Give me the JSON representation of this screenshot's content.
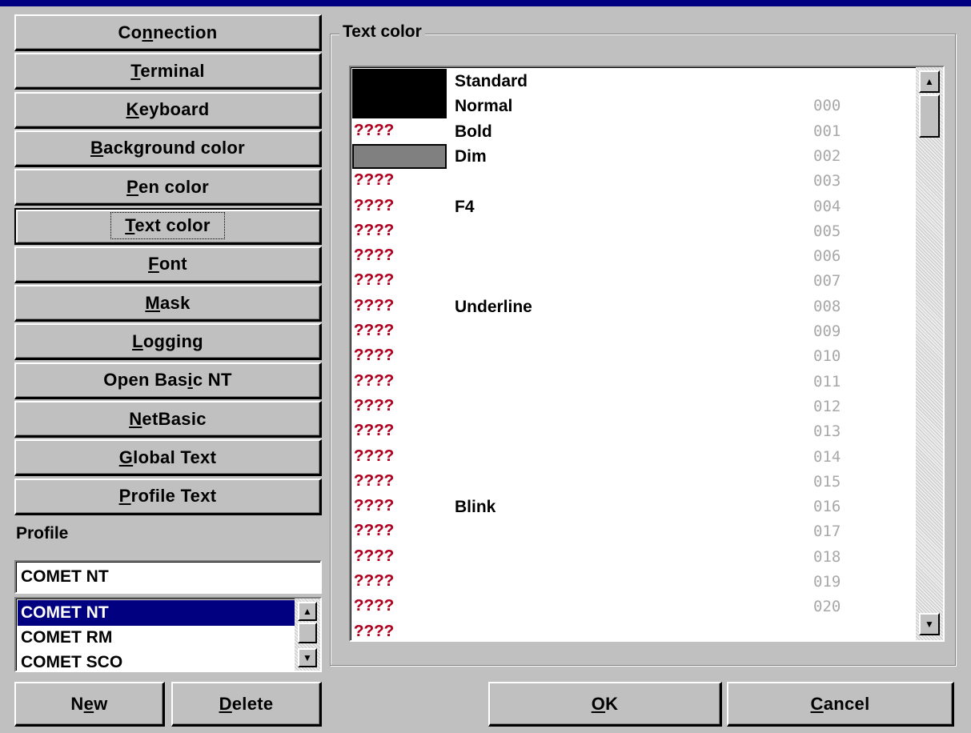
{
  "nav_buttons": [
    {
      "pre": "Co",
      "ul": "n",
      "post": "nection"
    },
    {
      "pre": "",
      "ul": "T",
      "post": "erminal"
    },
    {
      "pre": "",
      "ul": "K",
      "post": "eyboard"
    },
    {
      "pre": "",
      "ul": "B",
      "post": "ackground color"
    },
    {
      "pre": "",
      "ul": "P",
      "post": "en color"
    },
    {
      "pre": "",
      "ul": "T",
      "post": "ext color"
    },
    {
      "pre": "",
      "ul": "F",
      "post": "ont"
    },
    {
      "pre": "",
      "ul": "M",
      "post": "ask"
    },
    {
      "pre": "",
      "ul": "L",
      "post": "ogging"
    },
    {
      "pre": "Open Bas",
      "ul": "i",
      "post": "c NT"
    },
    {
      "pre": "",
      "ul": "N",
      "post": "etBasic"
    },
    {
      "pre": "",
      "ul": "G",
      "post": "lobal Text"
    },
    {
      "pre": "",
      "ul": "P",
      "post": "rofile Text"
    }
  ],
  "profile": {
    "label": "Profile",
    "input_value": "COMET NT",
    "list": [
      "COMET NT",
      "COMET RM",
      "COMET SCO"
    ],
    "selected_index": 0
  },
  "bottom_left": {
    "new": {
      "pre": "N",
      "ul": "e",
      "post": "w"
    },
    "delete": {
      "pre": "",
      "ul": "D",
      "post": "elete"
    }
  },
  "group": {
    "title": "Text color"
  },
  "color_list": {
    "rows": [
      {
        "swatch": "#000000",
        "name": "Standard",
        "code": ""
      },
      {
        "swatch": "#000000",
        "name": "Normal",
        "code": "000"
      },
      {
        "swatch": "",
        "name": "Bold",
        "code": "001",
        "q": "????"
      },
      {
        "swatch": "#808080",
        "name": "Dim",
        "code": "002"
      },
      {
        "swatch": "",
        "name": "",
        "code": "003",
        "q": "????"
      },
      {
        "swatch": "",
        "name": "F4",
        "code": "004",
        "q": "????"
      },
      {
        "swatch": "",
        "name": "",
        "code": "005",
        "q": "????"
      },
      {
        "swatch": "",
        "name": "",
        "code": "006",
        "q": "????"
      },
      {
        "swatch": "",
        "name": "",
        "code": "007",
        "q": "????"
      },
      {
        "swatch": "",
        "name": "Underline",
        "code": "008",
        "q": "????"
      },
      {
        "swatch": "",
        "name": "",
        "code": "009",
        "q": "????"
      },
      {
        "swatch": "",
        "name": "",
        "code": "010",
        "q": "????"
      },
      {
        "swatch": "",
        "name": "",
        "code": "011",
        "q": "????"
      },
      {
        "swatch": "",
        "name": "",
        "code": "012",
        "q": "????"
      },
      {
        "swatch": "",
        "name": "",
        "code": "013",
        "q": "????"
      },
      {
        "swatch": "",
        "name": "",
        "code": "014",
        "q": "????"
      },
      {
        "swatch": "",
        "name": "",
        "code": "015",
        "q": "????"
      },
      {
        "swatch": "",
        "name": "Blink",
        "code": "016",
        "q": "????"
      },
      {
        "swatch": "",
        "name": "",
        "code": "017",
        "q": "????"
      },
      {
        "swatch": "",
        "name": "",
        "code": "018",
        "q": "????"
      },
      {
        "swatch": "",
        "name": "",
        "code": "019",
        "q": "????"
      },
      {
        "swatch": "",
        "name": "",
        "code": "020",
        "q": "????"
      },
      {
        "swatch": "",
        "name": "",
        "code": "",
        "q": "????"
      }
    ]
  },
  "dialog_buttons": {
    "ok": {
      "pre": "",
      "ul": "O",
      "post": "K"
    },
    "cancel": {
      "pre": "",
      "ul": "C",
      "post": "ancel"
    }
  },
  "colors": {
    "titlebar": "#000080",
    "face": "#c0c0c0",
    "selection": "#000080",
    "question_marks": "#b00020",
    "code_gray": "#a8a8a8"
  }
}
